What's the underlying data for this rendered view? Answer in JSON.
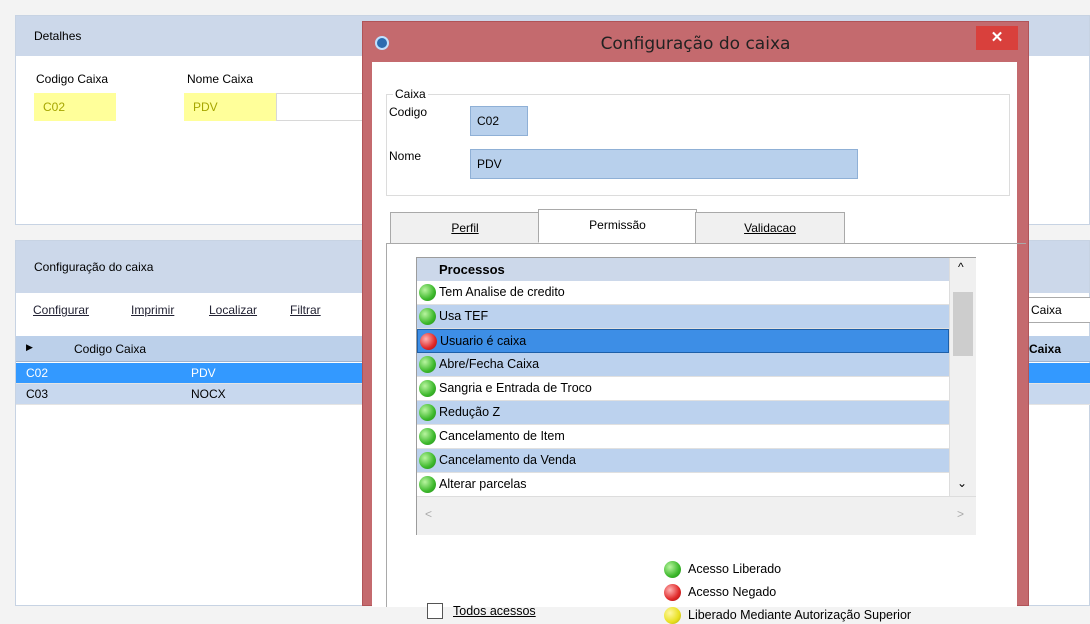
{
  "detalhes": {
    "title": "Detalhes",
    "codigo_label": "Codigo Caixa",
    "codigo_value": "C02",
    "nome_label": "Nome Caixa",
    "nome_value": "PDV"
  },
  "config_panel": {
    "title": "Configuração do caixa",
    "links": [
      "Configurar",
      "Imprimir",
      "Localizar",
      "Filtrar"
    ],
    "grid_col1": "Codigo Caixa",
    "right_field": "Caixa",
    "right_col": "Caixa",
    "rows": [
      {
        "codigo": "C02",
        "nome": "PDV"
      },
      {
        "codigo": "C03",
        "nome": "NOCX"
      }
    ]
  },
  "dialog": {
    "title": "Configuração do caixa",
    "close": "✕",
    "group_title": "Caixa",
    "codigo_label": "Codigo",
    "codigo_value": "C02",
    "nome_label": "Nome",
    "nome_value": "PDV",
    "tabs": [
      "Perfil",
      "Permissão",
      "Validacao"
    ],
    "list_header": "Processos",
    "processos": [
      {
        "name": "Tem Analise de credito",
        "status": "green"
      },
      {
        "name": "Usa TEF",
        "status": "green"
      },
      {
        "name": "Usuario é caixa",
        "status": "red"
      },
      {
        "name": "Abre/Fecha Caixa",
        "status": "green"
      },
      {
        "name": "Sangria e Entrada de Troco",
        "status": "green"
      },
      {
        "name": "Redução Z",
        "status": "green"
      },
      {
        "name": "Cancelamento de Item",
        "status": "green"
      },
      {
        "name": "Cancelamento da Venda",
        "status": "green"
      },
      {
        "name": "Alterar parcelas",
        "status": "green"
      }
    ],
    "legend": [
      {
        "label": "Acesso Liberado",
        "color": "green"
      },
      {
        "label": "Acesso Negado",
        "color": "red"
      },
      {
        "label": "Liberado Mediante Autorização Superior",
        "color": "yellow"
      }
    ],
    "todos_label": "Todos acessos"
  },
  "colors": {
    "selection": "#3399ff",
    "dialog_frame": "#c46a6e",
    "close_button": "#d9403c",
    "highlight_field": "#ffff9a"
  }
}
